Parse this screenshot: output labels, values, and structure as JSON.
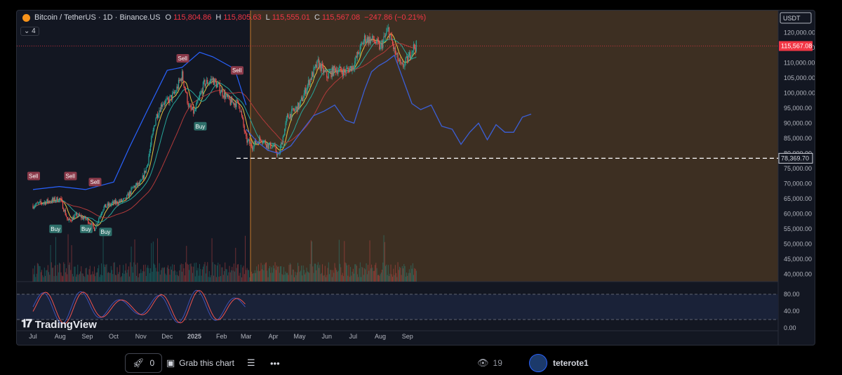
{
  "header": {
    "title": "Bitcoin / TetherUS · 1D · Binance.US",
    "ohlc": [
      {
        "k": "O",
        "v": "115,804.86"
      },
      {
        "k": "H",
        "v": "115,805.63"
      },
      {
        "k": "L",
        "v": "115,555.01"
      },
      {
        "k": "C",
        "v": "115,567.08"
      }
    ],
    "change": "−247.86 (−0.21%)",
    "indicator_count": "4"
  },
  "branding": {
    "logo_text": "TradingView"
  },
  "footer": {
    "boost_count": "0",
    "grab_label": "Grab this chart",
    "views": "19",
    "author": "teterote1"
  },
  "colors": {
    "background": "#131722",
    "up": "#26a69a",
    "down": "#ef5350",
    "projection": "#3b5fd6",
    "shade": "#3d2f22",
    "stoch_k": "#3f51b5",
    "stoch_d": "#ef5350"
  },
  "chart_data": [
    {
      "type": "candlestick",
      "title": "",
      "currency": "USDT",
      "y_ticks": [
        40000,
        45000,
        50000,
        55000,
        60000,
        65000,
        70000,
        75000,
        80000,
        85000,
        90000,
        95000,
        100000,
        105000,
        110000,
        115000,
        120000
      ],
      "y_tick_labels": [
        "40,000.00",
        "45,000.00",
        "50,000.00",
        "55,000.00",
        "60,000.00",
        "65,000.00",
        "70,000.00",
        "75,000.00",
        "80,000.00",
        "85,000.00",
        "90,000.00",
        "95,000.00",
        "100,000.00",
        "105,000.00",
        "110,000.00",
        "115,000.00",
        "120,000.00"
      ],
      "ylim": [
        37500,
        125000
      ],
      "x_labels": [
        "Jul",
        "Aug",
        "Sep",
        "Oct",
        "Nov",
        "Dec",
        "2025",
        "Feb",
        "Mar",
        "Apr",
        "May",
        "Jun",
        "Jul",
        "Aug",
        "Sep"
      ],
      "x_label_day_index": [
        0,
        31,
        62,
        92,
        123,
        153,
        184,
        215,
        243,
        274,
        304,
        335,
        365,
        396,
        427
      ],
      "last_price": 115567.08,
      "last_price_label": "115,567.08",
      "support_level": 78369.7,
      "support_label": "78,369.70",
      "shaded_region_start_day": 248,
      "monthly_closes": [
        {
          "day": 0,
          "close": 62700
        },
        {
          "day": 15,
          "close": 64000
        },
        {
          "day": 31,
          "close": 65000
        },
        {
          "day": 40,
          "close": 57500
        },
        {
          "day": 50,
          "close": 59500
        },
        {
          "day": 62,
          "close": 58000
        },
        {
          "day": 70,
          "close": 55000
        },
        {
          "day": 80,
          "close": 62000
        },
        {
          "day": 92,
          "close": 63500
        },
        {
          "day": 105,
          "close": 64500
        },
        {
          "day": 115,
          "close": 69000
        },
        {
          "day": 123,
          "close": 70000
        },
        {
          "day": 130,
          "close": 76000
        },
        {
          "day": 140,
          "close": 92000
        },
        {
          "day": 148,
          "close": 97000
        },
        {
          "day": 153,
          "close": 97000
        },
        {
          "day": 162,
          "close": 100000
        },
        {
          "day": 170,
          "close": 106000
        },
        {
          "day": 178,
          "close": 95000
        },
        {
          "day": 184,
          "close": 93500
        },
        {
          "day": 195,
          "close": 103000
        },
        {
          "day": 205,
          "close": 104500
        },
        {
          "day": 215,
          "close": 100500
        },
        {
          "day": 225,
          "close": 97000
        },
        {
          "day": 235,
          "close": 96500
        },
        {
          "day": 243,
          "close": 84500
        },
        {
          "day": 250,
          "close": 82500
        },
        {
          "day": 260,
          "close": 85000
        },
        {
          "day": 268,
          "close": 82500
        },
        {
          "day": 274,
          "close": 82500
        },
        {
          "day": 280,
          "close": 79000
        },
        {
          "day": 290,
          "close": 92000
        },
        {
          "day": 304,
          "close": 96000
        },
        {
          "day": 315,
          "close": 104000
        },
        {
          "day": 325,
          "close": 110000
        },
        {
          "day": 335,
          "close": 105500
        },
        {
          "day": 345,
          "close": 108000
        },
        {
          "day": 355,
          "close": 107000
        },
        {
          "day": 365,
          "close": 109000
        },
        {
          "day": 378,
          "close": 118000
        },
        {
          "day": 388,
          "close": 117500
        },
        {
          "day": 396,
          "close": 115000
        },
        {
          "day": 405,
          "close": 121000
        },
        {
          "day": 413,
          "close": 113000
        },
        {
          "day": 420,
          "close": 108500
        },
        {
          "day": 427,
          "close": 111000
        },
        {
          "day": 433,
          "close": 115000
        },
        {
          "day": 437,
          "close": 115567
        }
      ],
      "projection_line": [
        {
          "day": 243,
          "value": 88000
        },
        {
          "day": 255,
          "value": 84000
        },
        {
          "day": 268,
          "value": 81000
        },
        {
          "day": 280,
          "value": 80000
        },
        {
          "day": 294,
          "value": 82500
        },
        {
          "day": 308,
          "value": 88000
        },
        {
          "day": 320,
          "value": 92500
        },
        {
          "day": 332,
          "value": 94000
        },
        {
          "day": 344,
          "value": 96000
        },
        {
          "day": 356,
          "value": 91000
        },
        {
          "day": 366,
          "value": 90000
        },
        {
          "day": 378,
          "value": 101000
        },
        {
          "day": 386,
          "value": 107000
        },
        {
          "day": 394,
          "value": 109000
        },
        {
          "day": 403,
          "value": 110500
        },
        {
          "day": 412,
          "value": 112500
        },
        {
          "day": 422,
          "value": 104500
        },
        {
          "day": 432,
          "value": 96500
        },
        {
          "day": 442,
          "value": 94500
        },
        {
          "day": 454,
          "value": 96000
        },
        {
          "day": 466,
          "value": 89000
        },
        {
          "day": 478,
          "value": 88000
        },
        {
          "day": 488,
          "value": 83000
        },
        {
          "day": 498,
          "value": 87000
        },
        {
          "day": 508,
          "value": 90000
        },
        {
          "day": 518,
          "value": 84500
        },
        {
          "day": 528,
          "value": 89500
        },
        {
          "day": 538,
          "value": 87000
        },
        {
          "day": 548,
          "value": 87000
        },
        {
          "day": 558,
          "value": 92000
        },
        {
          "day": 568,
          "value": 93000
        }
      ],
      "upper_band": [
        {
          "day": 0,
          "value": 68000
        },
        {
          "day": 30,
          "value": 69000
        },
        {
          "day": 60,
          "value": 68000
        },
        {
          "day": 92,
          "value": 70500
        },
        {
          "day": 110,
          "value": 82000
        },
        {
          "day": 130,
          "value": 94000
        },
        {
          "day": 153,
          "value": 107500
        },
        {
          "day": 170,
          "value": 108500
        },
        {
          "day": 190,
          "value": 113500
        },
        {
          "day": 205,
          "value": 112000
        },
        {
          "day": 230,
          "value": 108000
        },
        {
          "day": 243,
          "value": 96000
        }
      ],
      "signals": [
        {
          "label": "Sell",
          "day": 0,
          "price": 69000
        },
        {
          "label": "Sell",
          "day": 42,
          "price": 69000
        },
        {
          "label": "Sell",
          "day": 70,
          "price": 67000
        },
        {
          "label": "Buy",
          "day": 25,
          "price": 58000
        },
        {
          "label": "Buy",
          "day": 60,
          "price": 58000
        },
        {
          "label": "Buy",
          "day": 82,
          "price": 57000
        },
        {
          "label": "Sell",
          "day": 170,
          "price": 108000
        },
        {
          "label": "Sell",
          "day": 232,
          "price": 104000
        },
        {
          "label": "Buy",
          "day": 190,
          "price": 92000
        }
      ]
    },
    {
      "type": "line",
      "title": "",
      "ylim": [
        0,
        100
      ],
      "y_ticks": [
        0,
        40,
        80
      ],
      "y_tick_labels": [
        "0.00",
        "40.00",
        "80.00"
      ],
      "levels": [
        20,
        80
      ]
    }
  ]
}
